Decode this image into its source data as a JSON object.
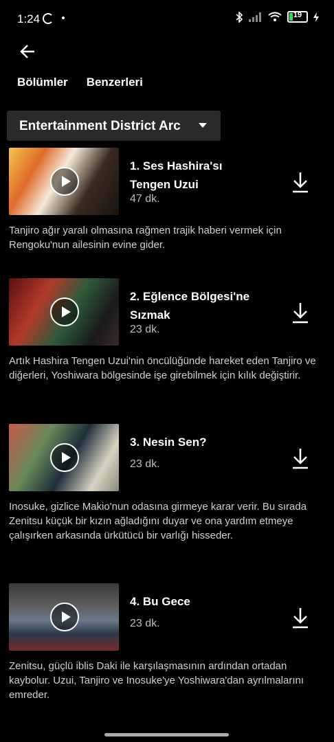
{
  "status_bar": {
    "time": "1:24",
    "battery": "19"
  },
  "tabs": [
    "Bölümler",
    "Benzerleri"
  ],
  "season": {
    "label": "Entertainment District Arc"
  },
  "episodes": [
    {
      "title": "1. Ses Hashira'sı Tengen Uzui",
      "duration": "47 dk.",
      "description": "Tanjiro ağır yaralı olmasına rağmen trajik haberi vermek için Rengoku'nun ailesinin evine gider."
    },
    {
      "title": "2. Eğlence Bölgesi'ne Sızmak",
      "duration": "23 dk.",
      "description": "Artık Hashira Tengen Uzui'nin öncülüğünde hareket eden Tanjiro ve diğerleri, Yoshiwara bölgesinde işe girebilmek için kılık değiştirir."
    },
    {
      "title": "3. Nesin Sen?",
      "duration": "23 dk.",
      "description": "Inosuke, gizlice Makio'nun odasına girmeye karar verir. Bu sırada Zenitsu küçük bir kızın ağladığını duyar ve ona yardım etmeye çalışırken arkasında ürkütücü bir varlığı hisseder."
    },
    {
      "title": "4. Bu Gece",
      "duration": "23 dk.",
      "description": "Zenitsu, güçlü iblis Daki ile karşılaşmasının ardından ortadan kaybolur. Uzui, Tanjiro ve Inosuke'ye Yoshiwara'dan ayrılmalarını emreder."
    }
  ]
}
